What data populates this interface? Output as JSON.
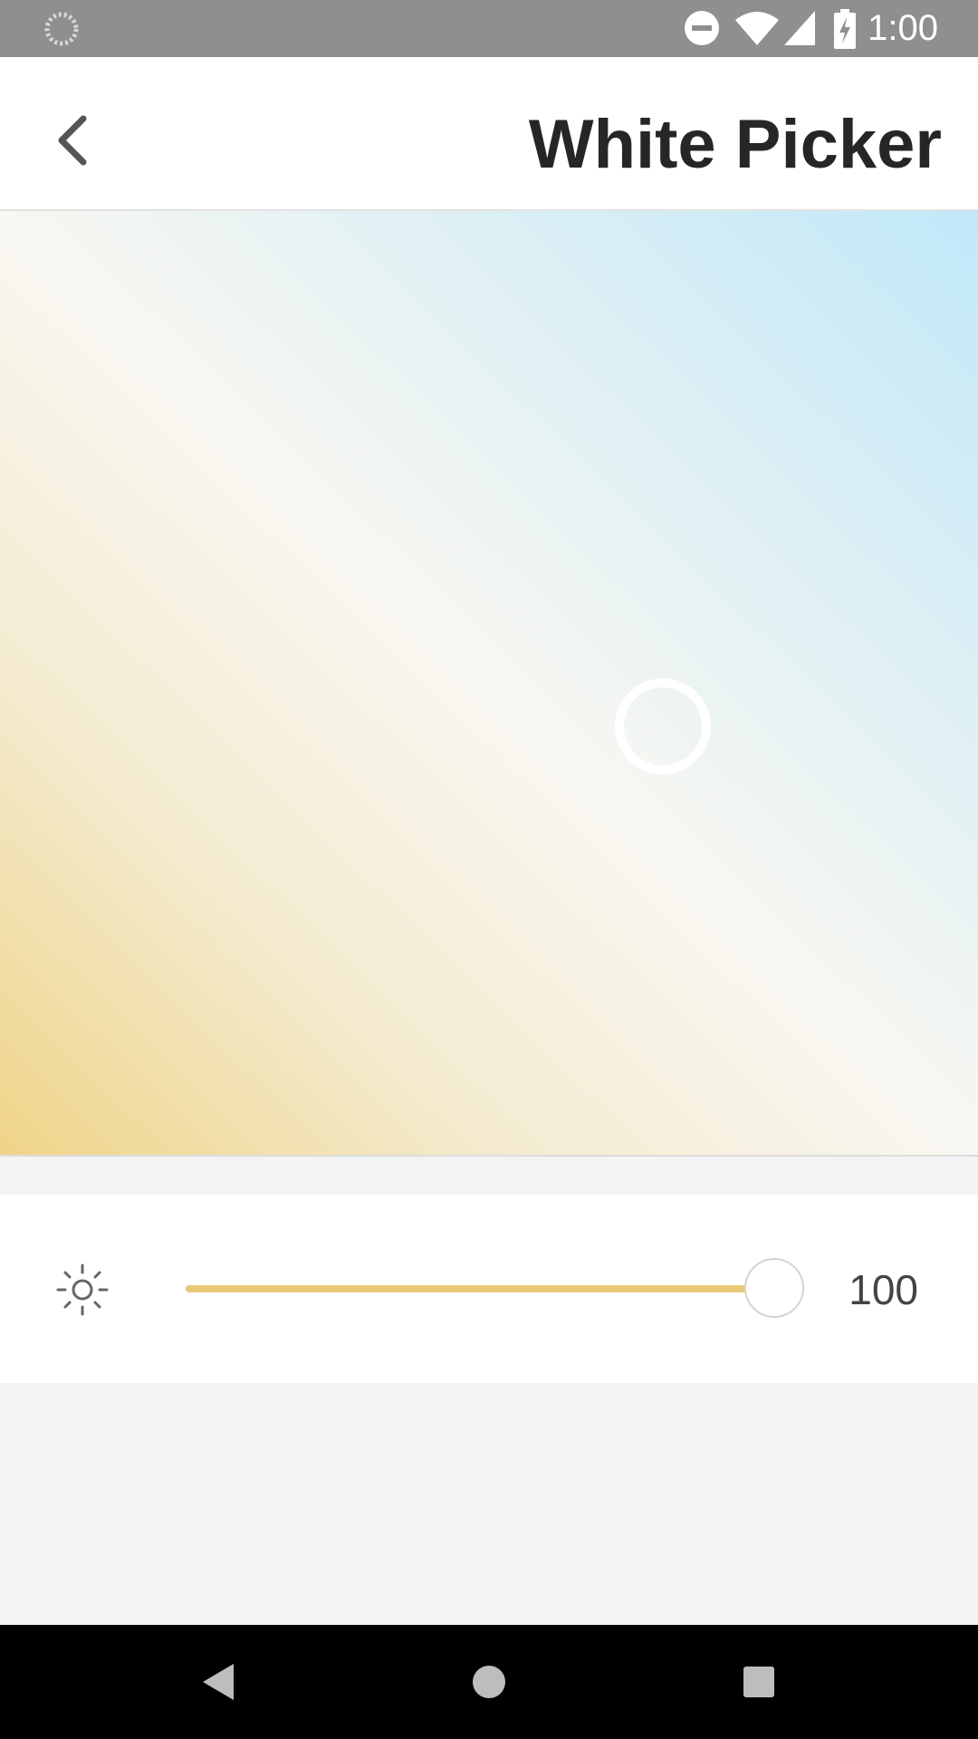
{
  "status_bar": {
    "time": "1:00",
    "icons": [
      "loading-icon",
      "do-not-disturb-icon",
      "wifi-icon",
      "cell-signal-icon",
      "battery-charging-icon"
    ]
  },
  "app_bar": {
    "title": "White Picker",
    "back_icon": "chevron-left-icon"
  },
  "picker": {
    "warm_color": "#efd488",
    "neutral_color": "#f8f7f2",
    "cool_color": "#c1e8f8"
  },
  "brightness": {
    "icon": "sun-icon",
    "value": "100",
    "level": 1.0,
    "accent_color": "#ebc878"
  },
  "nav_bar": {
    "buttons": [
      "back-triangle-icon",
      "home-circle-icon",
      "recents-square-icon"
    ]
  }
}
